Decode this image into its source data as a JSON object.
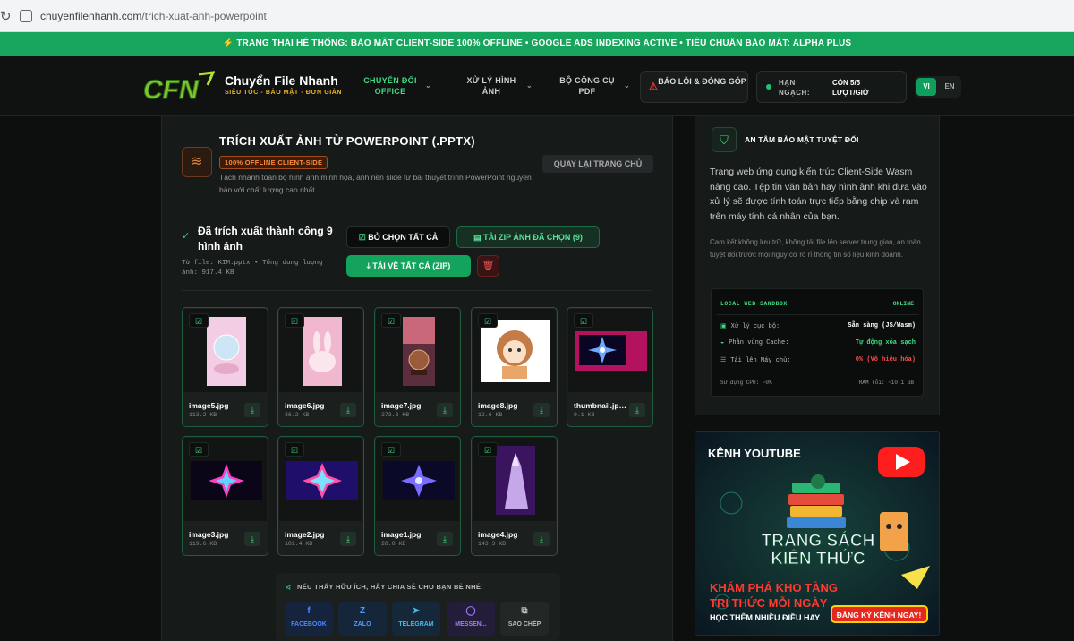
{
  "browser": {
    "url_host": "chuyenfilenhanh.com",
    "url_path": "/trich-xuat-anh-powerpoint"
  },
  "status_bar": "⚡ TRẠNG THÁI HỆ THỐNG: BẢO MẬT CLIENT-SIDE 100% OFFLINE • GOOGLE ADS INDEXING ACTIVE • TIÊU CHUẨN BẢO MẬT: ALPHA PLUS",
  "header": {
    "logo_text": "CFN",
    "brand": "Chuyển File Nhanh",
    "tagline": "SIÊU TỐC - BẢO MẬT - ĐƠN GIẢN",
    "nav": [
      {
        "label": "CHUYỂN ĐỔI OFFICE",
        "color": "#3ddc84"
      },
      {
        "label": "XỬ LÝ HÌNH ẢNH",
        "color": "#cfcfcf"
      },
      {
        "label": "BỘ CÔNG CỤ PDF",
        "color": "#cfcfcf"
      }
    ],
    "report": "BÁO LỖI & ĐÓNG GÓP",
    "quota_label": "HẠN NGẠCH:",
    "quota_value": "CÒN 5/5 LƯỢT/GIỜ",
    "lang": [
      "VI",
      "EN"
    ]
  },
  "tool": {
    "title": "TRÍCH XUẤT ẢNH TỪ POWERPOINT (.PPTX)",
    "badge": "100% OFFLINE CLIENT-SIDE",
    "description": "Tách nhanh toàn bộ hình ảnh minh họa, ảnh nền slide từ bài thuyết trình PowerPoint nguyên bản với chất lượng cao nhất.",
    "back": "QUAY LẠI TRANG CHỦ"
  },
  "result": {
    "success": "Đã trích xuất thành công 9 hình ảnh",
    "fileinfo": "Từ file: KIM.pptx • Tổng dung lượng ảnh: 917.4 KB",
    "deselect": "BỎ CHỌN TẤT CẢ",
    "zip_selected": "TẢI ZIP ẢNH ĐÃ CHỌN (9)",
    "zip_all": "TẢI VỀ TẤT CẢ (ZIP)"
  },
  "images": [
    {
      "name": "image5.jpg",
      "size": "113.2 KB",
      "thumb": "bubble-pink"
    },
    {
      "name": "image6.jpg",
      "size": "36.2 KB",
      "thumb": "bunny-pink"
    },
    {
      "name": "image7.jpg",
      "size": "273.3 KB",
      "thumb": "globe-brown"
    },
    {
      "name": "image8.jpg",
      "size": "12.6 KB",
      "thumb": "anime-girl"
    },
    {
      "name": "thumbnail.jpeg",
      "size": "9.1 KB",
      "thumb": "star-purple"
    },
    {
      "name": "image3.jpg",
      "size": "119.6 KB",
      "thumb": "star-pink"
    },
    {
      "name": "image2.jpg",
      "size": "181.4 KB",
      "thumb": "star-blue"
    },
    {
      "name": "image1.jpg",
      "size": "28.8 KB",
      "thumb": "star-violet"
    },
    {
      "name": "image4.jpg",
      "size": "143.3 KB",
      "thumb": "wolf-purple"
    }
  ],
  "share": {
    "title": "NẾU THẤY HỮU ÍCH, HÃY CHIA SẺ CHO BẠN BÈ NHÉ:",
    "buttons": [
      {
        "label": "FACEBOOK",
        "icon": "f",
        "color": "#4d87ff",
        "bg": "#16233d"
      },
      {
        "label": "ZALO",
        "icon": "Z",
        "color": "#4d9bff",
        "bg": "#15253a"
      },
      {
        "label": "TELEGRAM",
        "icon": "➤",
        "color": "#4cb6e8",
        "bg": "#15283a"
      },
      {
        "label": "MESSEN...",
        "icon": "◯",
        "color": "#a37bff",
        "bg": "#241d3a"
      },
      {
        "label": "SAO CHÉP",
        "icon": "⧉",
        "color": "#bbbbbb",
        "bg": "#232726"
      }
    ]
  },
  "security": {
    "title": "AN TÂM BẢO MẬT TUYỆT ĐỐI",
    "desc": "Trang web ứng dụng kiến trúc Client-Side Wasm nâng cao. Tệp tin văn bản hay hình ảnh khi đưa vào xử lý sẽ được tính toán trực tiếp bằng chip và ram trên máy tính cá nhân của bạn.",
    "note": "Cam kết không lưu trữ, không tải file lên server trung gian, an toàn tuyệt đối trước mọi nguy cơ rò rỉ thông tin số liệu kinh doanh.",
    "sandbox": {
      "title": "LOCAL WEB SANDBOX",
      "state": "ONLINE",
      "rows": [
        {
          "label": "Xử lý cục bộ:",
          "value": "Sẵn sàng (JS/Wasm)",
          "color": "#ffffff"
        },
        {
          "label": "Phân vùng Cache:",
          "value": "Tự động xóa sạch",
          "color": "#3ddc84"
        },
        {
          "label": "Tải lên Máy chủ:",
          "value": "0% (Vô hiệu hóa)",
          "color": "#ff4d4d"
        }
      ],
      "cpu": "Sử dụng CPU: ~0%",
      "ram": "RAM rỗi: ~10.1 GB"
    }
  },
  "youtube": {
    "line1": "KÊNH YOUTUBE",
    "line2": "TRANG SÁCH",
    "line3": "KIẾN THỨC",
    "line4": "KHÁM PHÁ KHO TÀNG",
    "line5": "TRI THỨC MỖI NGÀY",
    "line6": "HỌC THÊM NHIỀU ĐIỀU HAY",
    "cta": "ĐĂNG KÝ KÊNH NGAY!"
  }
}
